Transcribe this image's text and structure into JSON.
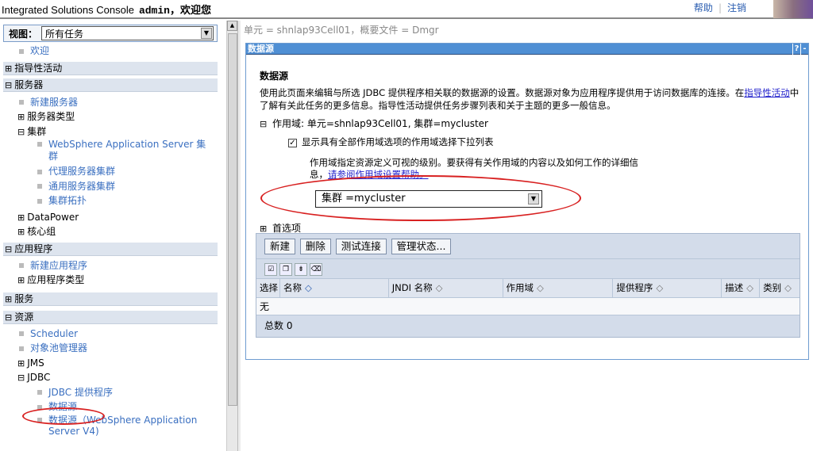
{
  "header": {
    "title": "Integrated Solutions Console",
    "user": "admin，欢迎您",
    "help": "帮助",
    "logout": "注销"
  },
  "nav": {
    "view_label": "视图：",
    "view_value": "所有任务",
    "welcome": "欢迎",
    "sections": {
      "guided": "指导性活动",
      "servers": "服务器",
      "apps": "应用程序",
      "services": "服务",
      "resources": "资源"
    },
    "servers": {
      "new_server": "新建服务器",
      "server_types": "服务器类型",
      "clusters": "集群",
      "was_cluster_1": "WebSphere Application Server 集",
      "was_cluster_2": "群",
      "proxy_cluster": "代理服务器集群",
      "generic_cluster": "通用服务器集群",
      "cluster_topology": "集群拓扑",
      "datapower": "DataPower",
      "core_groups": "核心组"
    },
    "apps": {
      "new_app": "新建应用程序",
      "app_types": "应用程序类型"
    },
    "resources": {
      "scheduler": "Scheduler",
      "object_pool": "对象池管理器",
      "jms": "JMS",
      "jdbc": "JDBC",
      "jdbc_providers": "JDBC 提供程序",
      "data_sources": "数据源",
      "data_sources_v4_1": "数据源（WebSphere Application",
      "data_sources_v4_2": "Server V4)"
    }
  },
  "main": {
    "breadcrumb": "单元 = shnlap93Cell01，概要文件 = Dmgr",
    "panel_title": "数据源",
    "help_btn": "?",
    "min_btn": "-",
    "heading": "数据源",
    "desc_1": "使用此页面来编辑与所选 JDBC 提供程序相关联的数据源的设置。数据源对象为应用程序提供用于访问数据库的连接。在",
    "desc_link": "指导性活动",
    "desc_2": "中了解有关此任务的更多信息。指导性活动提供任务步骤列表和关于主题的更多一般信息。",
    "scope": "作用域: 单元=shnlap93Cell01, 集群=mycluster",
    "show_all_scopes": "显示具有全部作用域选项的作用域选择下拉列表",
    "scope_info": "作用域指定资源定义可视的级别。要获得有关作用域的内容以及如何工作的详细信息，",
    "scope_help_link": "请参阅作用域设置帮助。",
    "scope_value": "集群 =mycluster",
    "preferences": "首选项",
    "buttons": [
      "新建",
      "删除",
      "测试连接",
      "管理状态..."
    ],
    "columns": [
      "选择",
      "名称",
      "JNDI 名称",
      "作用域",
      "提供程序",
      "描述",
      "类别"
    ],
    "empty": "无",
    "total": "总数 0"
  }
}
